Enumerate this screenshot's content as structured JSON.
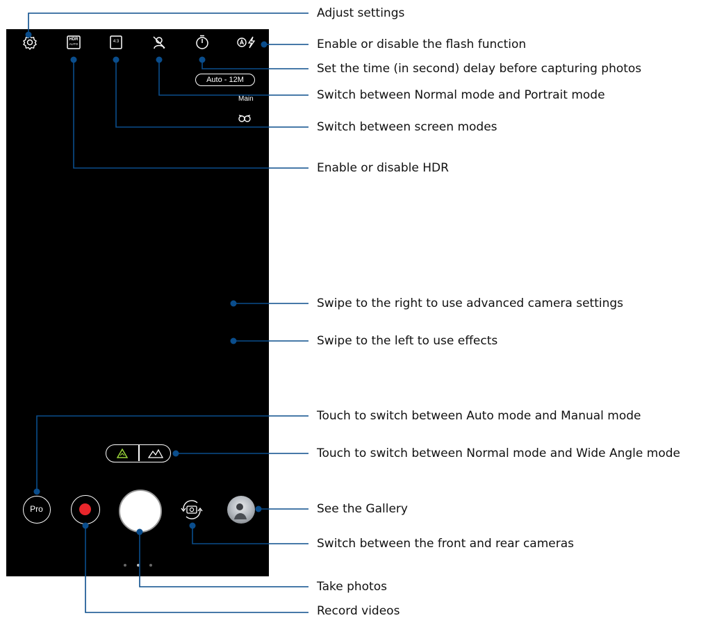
{
  "status": {
    "resolution": "Auto - 12M",
    "camera": "Main"
  },
  "controls": {
    "pro_label": "Pro",
    "hdr_label_top": "HDR",
    "hdr_label_bottom": "AUTO",
    "ratio_label": "4:3"
  },
  "callouts": {
    "adjust_settings": "Adjust settings",
    "flash": "Enable or disable the flash function",
    "timer": "Set the time (in second) delay before capturing photos",
    "portrait": "Switch between Normal mode and Portrait mode",
    "screen_modes": "Switch between screen modes",
    "hdr": "Enable or disable HDR",
    "swipe_right": "Swipe to the right to use advanced camera settings",
    "swipe_left": "Swipe to the left to use effects",
    "pro_mode": "Touch to switch between Auto mode and Manual mode",
    "wide_angle": "Touch to switch between Normal mode and Wide Angle mode",
    "gallery": "See the Gallery",
    "switch_camera": "Switch between the front and rear cameras",
    "take_photos": "Take photos",
    "record_videos": "Record videos"
  },
  "colors": {
    "callout_line": "#0a4d8c",
    "record": "#e8262b",
    "wide_active": "#9ad63a"
  }
}
